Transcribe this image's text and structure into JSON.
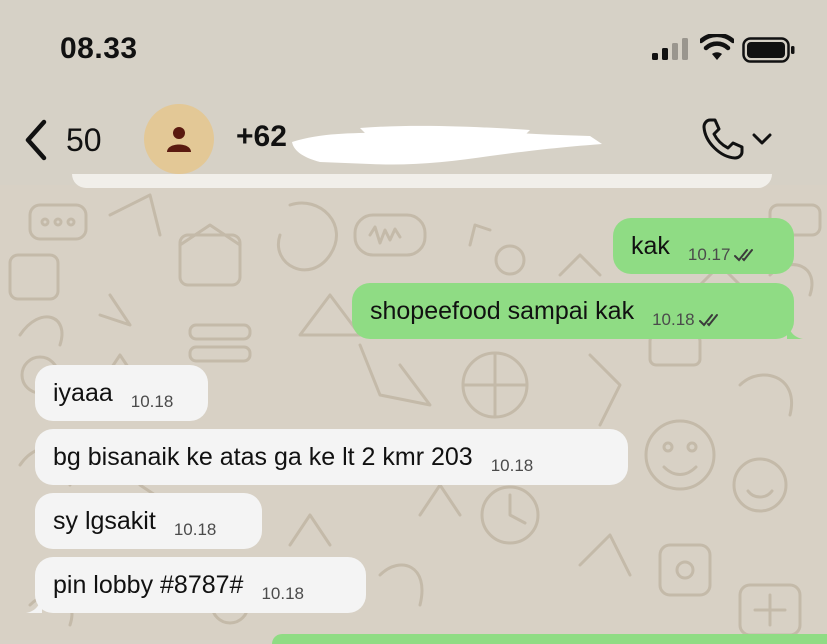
{
  "status_bar": {
    "time": "08.33",
    "icons": [
      "signal-icon",
      "wifi-icon",
      "battery-icon"
    ]
  },
  "header": {
    "back_count": "50",
    "contact_visible": "+62",
    "icons": [
      "chevron-left-icon",
      "person-icon",
      "phone-icon",
      "chevron-down-icon"
    ]
  },
  "colors": {
    "outgoing_bubble": "#8fdc84",
    "incoming_bubble": "#f4f4f4",
    "chat_background": "#d8d1c5",
    "avatar_bg": "#e3c896",
    "avatar_icon": "#5a1a10"
  },
  "messages": [
    {
      "direction": "out",
      "text": "kak",
      "time": "10.17",
      "read": true
    },
    {
      "direction": "out",
      "text": "shopeefood sampai kak",
      "time": "10.18",
      "read": true
    },
    {
      "direction": "in",
      "text": "iyaaa",
      "time": "10.18"
    },
    {
      "direction": "in",
      "text": "bg bisanaik ke atas ga ke lt 2 kmr 203",
      "time": "10.18"
    },
    {
      "direction": "in",
      "text": "sy lgsakit",
      "time": "10.18"
    },
    {
      "direction": "in",
      "text": "pin lobby #8787#",
      "time": "10.18"
    }
  ]
}
